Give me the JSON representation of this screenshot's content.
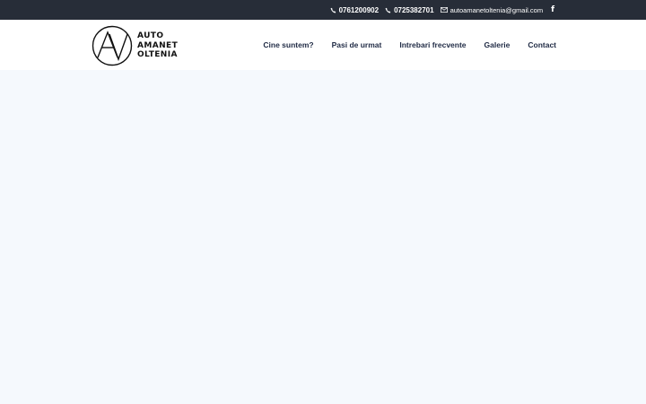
{
  "topbar": {
    "phone1": "0761200902",
    "phone2": "0725382701",
    "email": "autoamanetoltenia@gmail.com",
    "facebook_glyph": "f",
    "icons": [
      "phone-icon",
      "phone-icon",
      "mail-icon",
      "facebook-icon"
    ]
  },
  "logo": {
    "line1": "AUTO",
    "line2": "AMANET",
    "line3": "OLTENIA",
    "emblem_letters": "AV"
  },
  "nav": {
    "items": [
      {
        "label": "Cine suntem?"
      },
      {
        "label": "Pasi de urmat"
      },
      {
        "label": "Intrebari frecvente"
      },
      {
        "label": "Galerie"
      },
      {
        "label": "Contact"
      }
    ]
  },
  "colors": {
    "topbar_bg": "#272d38",
    "header_bg": "#ffffff",
    "page_bg": "#f5f9fd",
    "nav_text": "#1f2a44"
  }
}
